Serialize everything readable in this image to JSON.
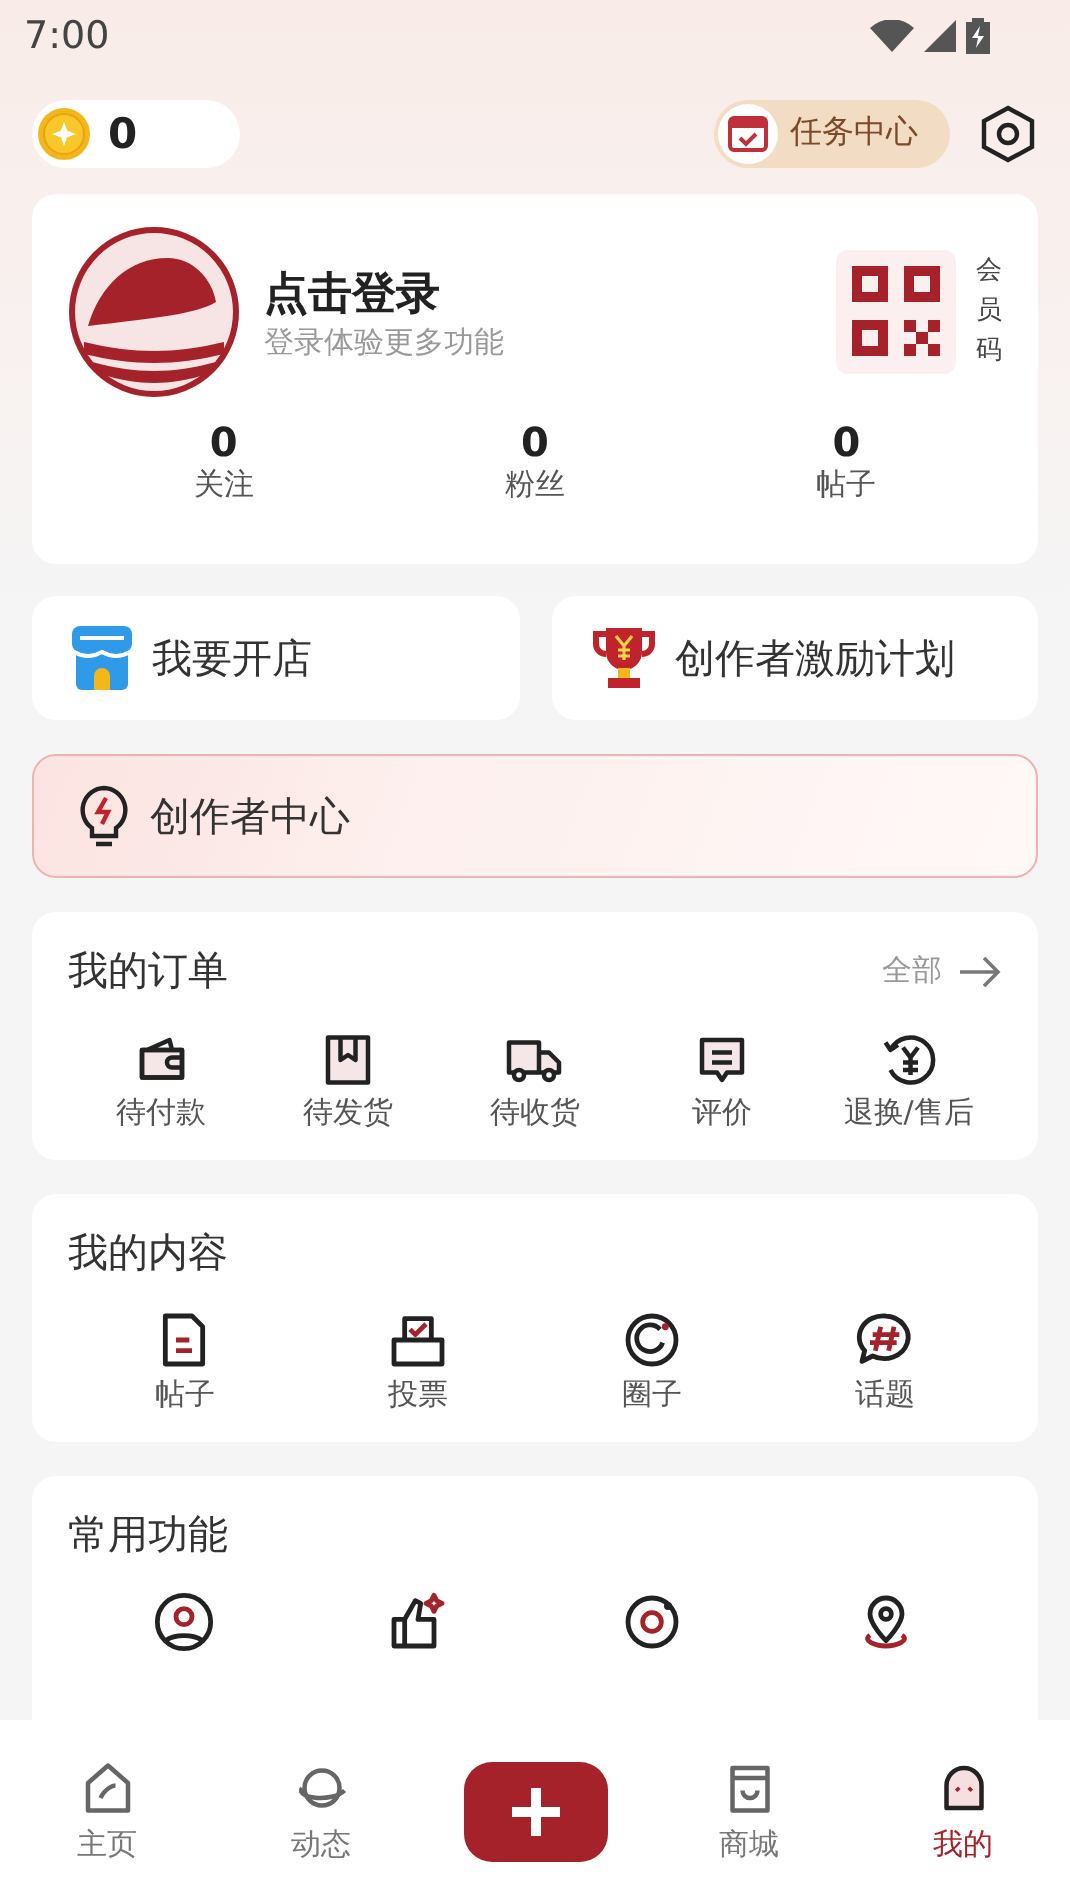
{
  "status_bar": {
    "time": "7:00"
  },
  "coins": {
    "count": "0"
  },
  "task_center": {
    "label": "任务中心"
  },
  "profile": {
    "title": "点击登录",
    "subtitle": "登录体验更多功能",
    "member_code": "会员码",
    "stats": [
      {
        "value": "0",
        "label": "关注"
      },
      {
        "value": "0",
        "label": "粉丝"
      },
      {
        "value": "0",
        "label": "帖子"
      }
    ]
  },
  "shortcuts": [
    {
      "label": "我要开店"
    },
    {
      "label": "创作者激励计划"
    }
  ],
  "creator_center": {
    "label": "创作者中心"
  },
  "orders": {
    "title": "我的订单",
    "all_link": "全部",
    "items": [
      {
        "label": "待付款"
      },
      {
        "label": "待发货"
      },
      {
        "label": "待收货"
      },
      {
        "label": "评价"
      },
      {
        "label": "退换/售后"
      }
    ]
  },
  "my_content": {
    "title": "我的内容",
    "items": [
      {
        "label": "帖子"
      },
      {
        "label": "投票"
      },
      {
        "label": "圈子"
      },
      {
        "label": "话题"
      }
    ]
  },
  "common_functions": {
    "title": "常用功能"
  },
  "bottom_nav": [
    {
      "kind": "tab",
      "label": "主页",
      "selected": false
    },
    {
      "kind": "tab",
      "label": "动态",
      "selected": false
    },
    {
      "kind": "add"
    },
    {
      "kind": "tab",
      "label": "商城",
      "selected": false
    },
    {
      "kind": "tab",
      "label": "我的",
      "selected": true
    }
  ]
}
